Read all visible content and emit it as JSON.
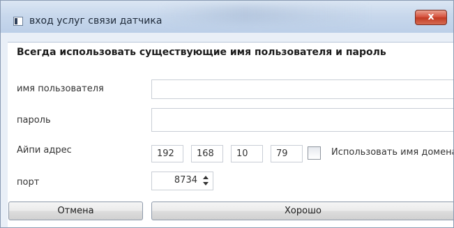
{
  "window": {
    "title": "вход услуг связи датчика",
    "close_label": "x"
  },
  "form": {
    "heading": "Всегда использовать существующие имя пользователя и пароль",
    "username": {
      "label": "имя пользователя",
      "value": ""
    },
    "password": {
      "label": "пароль",
      "value": ""
    },
    "ip": {
      "label": "Айпи адрес",
      "octets": [
        "192",
        "168",
        "10",
        "79"
      ],
      "domain_checkbox_checked": false,
      "domain_checkbox_label": "Использовать имя домена"
    },
    "port": {
      "label": "порт",
      "value": "8734"
    }
  },
  "buttons": {
    "cancel": "Отмена",
    "ok": "Хорошо"
  }
}
